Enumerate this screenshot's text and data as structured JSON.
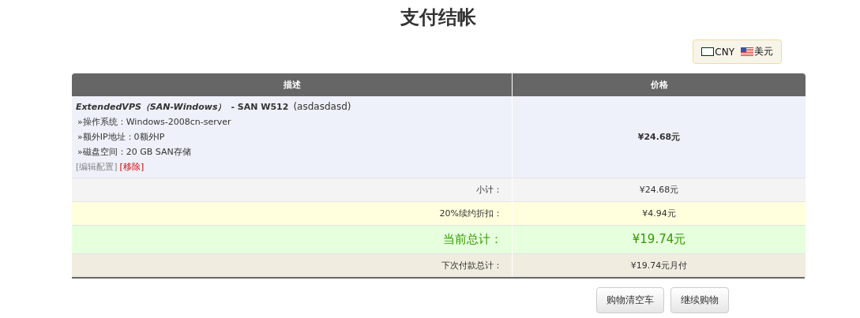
{
  "title": "支付结帐",
  "currencies": [
    {
      "kind": "box",
      "label": "CNY"
    },
    {
      "kind": "flag",
      "label": "美元"
    }
  ],
  "table": {
    "columns": [
      "描述",
      "价格"
    ],
    "item": {
      "product": "ExtendedVPS（SAN-Windows）",
      "plan": "- SAN W512",
      "hostname": "(asdasdasd)",
      "options": [
        "»操作系统：Windows-2008cn-server",
        "»额外IP地址：0额外IP",
        "»磁盘空间：20 GB SAN存储"
      ],
      "edit_link": "[编辑配置]",
      "remove_link": "[移除]",
      "price": "¥24.68元"
    },
    "totals": [
      {
        "kind": "subtotal",
        "label": "小计：",
        "value": "¥24.68元"
      },
      {
        "kind": "discount",
        "label": "20%续约折扣：",
        "value": "¥4.94元"
      },
      {
        "kind": "total",
        "label": "当前总计：",
        "value": "¥19.74元"
      },
      {
        "kind": "recurring",
        "label": "下次付款总计：",
        "value": "¥19.74元月付"
      }
    ]
  },
  "buttons": [
    "购物清空车",
    "继续购物"
  ]
}
